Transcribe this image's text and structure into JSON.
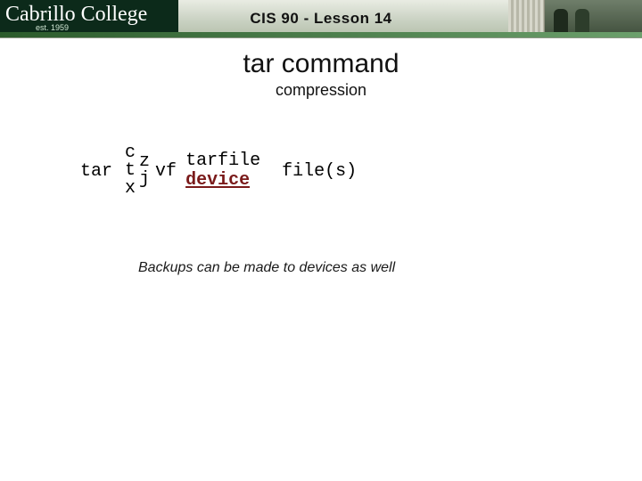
{
  "banner": {
    "title": "CIS 90 - Lesson 14",
    "logo_text": "Cabrillo College",
    "logo_sub": "est. 1959"
  },
  "slide": {
    "title": "tar command",
    "subtitle": "compression"
  },
  "syntax": {
    "cmd": "tar",
    "ops": {
      "c": "c",
      "t": "t",
      "x": "x"
    },
    "comp": {
      "z": "z",
      "j": "j"
    },
    "vf": "vf",
    "target": {
      "tarfile": "tarfile",
      "device": "device"
    },
    "files": "file(s)"
  },
  "caption": "Backups can be made to devices as well"
}
